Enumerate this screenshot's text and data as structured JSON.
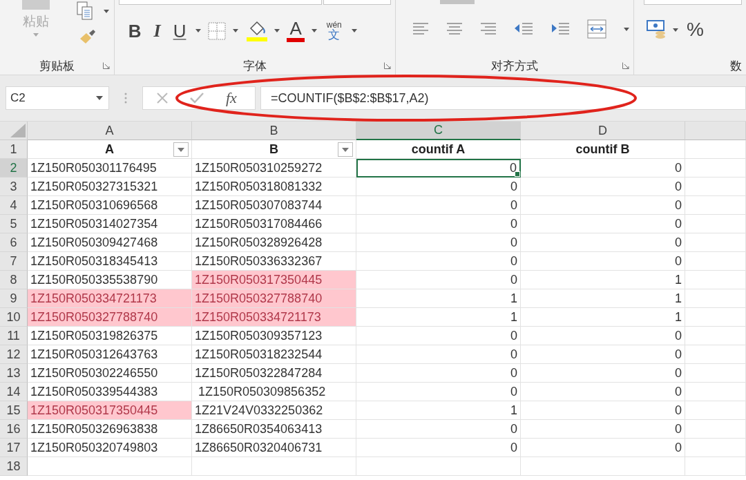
{
  "ribbon": {
    "clipboard": {
      "paste_label": "粘贴",
      "label": "剪贴板"
    },
    "font": {
      "label": "字体",
      "bold": "B",
      "italic": "I",
      "underline": "U",
      "font_color_letter": "A",
      "phonetic_top": "wén",
      "phonetic_bottom": "文"
    },
    "alignment": {
      "label": "对齐方式"
    },
    "number": {
      "percent": "%",
      "label": "数"
    }
  },
  "formula_bar": {
    "name_box": "C2",
    "fx": "fx",
    "formula": "=COUNTIF($B$2:$B$17,A2)"
  },
  "sheet": {
    "columns": [
      {
        "label": "A",
        "selected": false
      },
      {
        "label": "B",
        "selected": false
      },
      {
        "label": "C",
        "selected": true
      },
      {
        "label": "D",
        "selected": false
      }
    ],
    "header_row": {
      "num": "1",
      "cells": [
        {
          "text": "A",
          "filter": true
        },
        {
          "text": "B",
          "filter": true
        },
        {
          "text": "countif A",
          "filter": false
        },
        {
          "text": "countif B",
          "filter": false
        }
      ]
    },
    "rows": [
      {
        "num": "2",
        "selected": true,
        "cells": [
          {
            "text": "1Z150R050301176495",
            "highlighted": false,
            "selected": false
          },
          {
            "text": "1Z150R050310259272",
            "highlighted": false,
            "selected": false
          },
          {
            "text": "0",
            "highlighted": false,
            "selected": true
          },
          {
            "text": "0",
            "highlighted": false,
            "selected": false
          }
        ]
      },
      {
        "num": "3",
        "selected": false,
        "cells": [
          {
            "text": "1Z150R050327315321",
            "highlighted": false,
            "selected": false
          },
          {
            "text": "1Z150R050318081332",
            "highlighted": false,
            "selected": false
          },
          {
            "text": "0",
            "highlighted": false,
            "selected": false
          },
          {
            "text": "0",
            "highlighted": false,
            "selected": false
          }
        ]
      },
      {
        "num": "4",
        "selected": false,
        "cells": [
          {
            "text": "1Z150R050310696568",
            "highlighted": false,
            "selected": false
          },
          {
            "text": "1Z150R050307083744",
            "highlighted": false,
            "selected": false
          },
          {
            "text": "0",
            "highlighted": false,
            "selected": false
          },
          {
            "text": "0",
            "highlighted": false,
            "selected": false
          }
        ]
      },
      {
        "num": "5",
        "selected": false,
        "cells": [
          {
            "text": "1Z150R050314027354",
            "highlighted": false,
            "selected": false
          },
          {
            "text": "1Z150R050317084466",
            "highlighted": false,
            "selected": false
          },
          {
            "text": "0",
            "highlighted": false,
            "selected": false
          },
          {
            "text": "0",
            "highlighted": false,
            "selected": false
          }
        ]
      },
      {
        "num": "6",
        "selected": false,
        "cells": [
          {
            "text": "1Z150R050309427468",
            "highlighted": false,
            "selected": false
          },
          {
            "text": "1Z150R050328926428",
            "highlighted": false,
            "selected": false
          },
          {
            "text": "0",
            "highlighted": false,
            "selected": false
          },
          {
            "text": "0",
            "highlighted": false,
            "selected": false
          }
        ]
      },
      {
        "num": "7",
        "selected": false,
        "cells": [
          {
            "text": "1Z150R050318345413",
            "highlighted": false,
            "selected": false
          },
          {
            "text": "1Z150R050336332367",
            "highlighted": false,
            "selected": false
          },
          {
            "text": "0",
            "highlighted": false,
            "selected": false
          },
          {
            "text": "0",
            "highlighted": false,
            "selected": false
          }
        ]
      },
      {
        "num": "8",
        "selected": false,
        "cells": [
          {
            "text": "1Z150R050335538790",
            "highlighted": false,
            "selected": false
          },
          {
            "text": "1Z150R050317350445",
            "highlighted": true,
            "selected": false
          },
          {
            "text": "0",
            "highlighted": false,
            "selected": false
          },
          {
            "text": "1",
            "highlighted": false,
            "selected": false
          }
        ]
      },
      {
        "num": "9",
        "selected": false,
        "cells": [
          {
            "text": "1Z150R050334721173",
            "highlighted": true,
            "selected": false
          },
          {
            "text": "1Z150R050327788740",
            "highlighted": true,
            "selected": false
          },
          {
            "text": "1",
            "highlighted": false,
            "selected": false
          },
          {
            "text": "1",
            "highlighted": false,
            "selected": false
          }
        ]
      },
      {
        "num": "10",
        "selected": false,
        "cells": [
          {
            "text": "1Z150R050327788740",
            "highlighted": true,
            "selected": false
          },
          {
            "text": "1Z150R050334721173",
            "highlighted": true,
            "selected": false
          },
          {
            "text": "1",
            "highlighted": false,
            "selected": false
          },
          {
            "text": "1",
            "highlighted": false,
            "selected": false
          }
        ]
      },
      {
        "num": "11",
        "selected": false,
        "cells": [
          {
            "text": "1Z150R050319826375",
            "highlighted": false,
            "selected": false
          },
          {
            "text": "1Z150R050309357123",
            "highlighted": false,
            "selected": false
          },
          {
            "text": "0",
            "highlighted": false,
            "selected": false
          },
          {
            "text": "0",
            "highlighted": false,
            "selected": false
          }
        ]
      },
      {
        "num": "12",
        "selected": false,
        "cells": [
          {
            "text": "1Z150R050312643763",
            "highlighted": false,
            "selected": false
          },
          {
            "text": "1Z150R050318232544",
            "highlighted": false,
            "selected": false
          },
          {
            "text": "0",
            "highlighted": false,
            "selected": false
          },
          {
            "text": "0",
            "highlighted": false,
            "selected": false
          }
        ]
      },
      {
        "num": "13",
        "selected": false,
        "cells": [
          {
            "text": "1Z150R050302246550",
            "highlighted": false,
            "selected": false
          },
          {
            "text": "1Z150R050322847284",
            "highlighted": false,
            "selected": false
          },
          {
            "text": "0",
            "highlighted": false,
            "selected": false
          },
          {
            "text": "0",
            "highlighted": false,
            "selected": false
          }
        ]
      },
      {
        "num": "14",
        "selected": false,
        "cells": [
          {
            "text": "1Z150R050339544383",
            "highlighted": false,
            "selected": false
          },
          {
            "text": " 1Z150R050309856352",
            "highlighted": false,
            "selected": false
          },
          {
            "text": "0",
            "highlighted": false,
            "selected": false
          },
          {
            "text": "0",
            "highlighted": false,
            "selected": false
          }
        ]
      },
      {
        "num": "15",
        "selected": false,
        "cells": [
          {
            "text": "1Z150R050317350445",
            "highlighted": true,
            "selected": false
          },
          {
            "text": "1Z21V24V0332250362",
            "highlighted": false,
            "selected": false
          },
          {
            "text": "1",
            "highlighted": false,
            "selected": false
          },
          {
            "text": "0",
            "highlighted": false,
            "selected": false
          }
        ]
      },
      {
        "num": "16",
        "selected": false,
        "cells": [
          {
            "text": "1Z150R050326963838",
            "highlighted": false,
            "selected": false
          },
          {
            "text": "1Z86650R0354063413",
            "highlighted": false,
            "selected": false
          },
          {
            "text": "0",
            "highlighted": false,
            "selected": false
          },
          {
            "text": "0",
            "highlighted": false,
            "selected": false
          }
        ]
      },
      {
        "num": "17",
        "selected": false,
        "cells": [
          {
            "text": "1Z150R050320749803",
            "highlighted": false,
            "selected": false
          },
          {
            "text": "1Z86650R0320406731",
            "highlighted": false,
            "selected": false
          },
          {
            "text": "0",
            "highlighted": false,
            "selected": false
          },
          {
            "text": "0",
            "highlighted": false,
            "selected": false
          }
        ]
      },
      {
        "num": "18",
        "selected": false
      }
    ]
  }
}
